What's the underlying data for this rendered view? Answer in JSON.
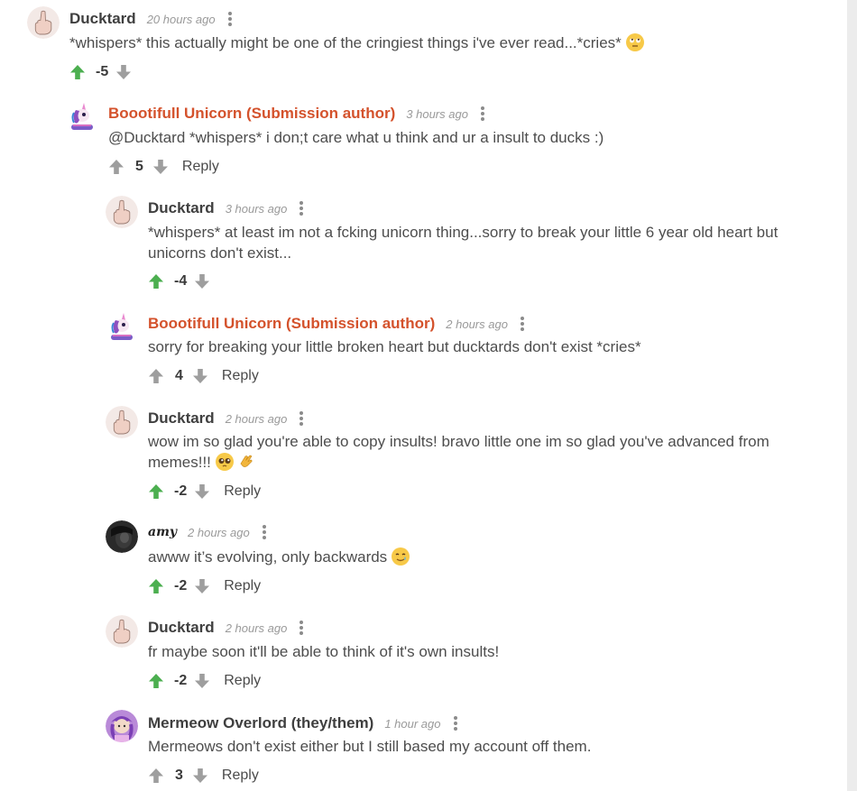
{
  "colors": {
    "upvote_active": "#4caf50",
    "vote_neutral": "#9e9e9e",
    "op_author": "#d4522c",
    "scrollbar": "#ececec"
  },
  "comments": [
    {
      "author": "Ducktard",
      "time": "20 hours ago",
      "text": "*whispers* this actually might be one of the cringiest things i've ever read...*cries*",
      "emoji": "face-with-rolling-eyes",
      "score": "-5",
      "upvoted": true,
      "reply_label": ""
    },
    {
      "author": "Boootifull Unicorn (Submission author)",
      "time": "3 hours ago",
      "text": "@Ducktard *whispers* i don;t care what u think and ur a insult to ducks :)",
      "score": "5",
      "upvoted": false,
      "reply_label": "Reply"
    },
    {
      "author": "Ducktard",
      "time": "3 hours ago",
      "text_line1": "*whispers* at least im not a fcking unicorn thing...sorry to break your little 6 year old heart but",
      "text_line2": "unicorns don't exist...",
      "score": "-4",
      "upvoted": true,
      "reply_label": ""
    },
    {
      "author": "Boootifull Unicorn (Submission author)",
      "time": "2 hours ago",
      "text": "sorry for breaking your little broken heart but ducktards don't exist *cries*",
      "score": "4",
      "upvoted": false,
      "reply_label": "Reply"
    },
    {
      "author": "Ducktard",
      "time": "2 hours ago",
      "text_line1": "wow im so glad you're able to copy insults! bravo little one im so glad you've advanced from",
      "text_line2": "memes!!!",
      "emoji": [
        "pleading-face",
        "clapping-hands"
      ],
      "score": "-2",
      "upvoted": true,
      "reply_label": "Reply"
    },
    {
      "author": "amy",
      "time": "2 hours ago",
      "text": "awww it’s evolving, only backwards",
      "emoji": "smiling-face-with-tear",
      "score": "-2",
      "upvoted": true,
      "reply_label": "Reply"
    },
    {
      "author": "Ducktard",
      "time": "2 hours ago",
      "text": "fr maybe soon it'll be able to think of it's own insults!",
      "score": "-2",
      "upvoted": true,
      "reply_label": "Reply"
    },
    {
      "author": "Mermeow Overlord (they/them)",
      "time": "1 hour ago",
      "text": "Mermeows don't exist either but I still based my account off them.",
      "score": "3",
      "upvoted": false,
      "reply_label": "Reply"
    }
  ]
}
